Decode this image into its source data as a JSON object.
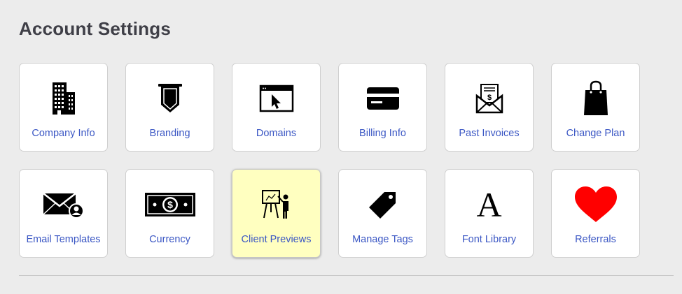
{
  "page": {
    "title": "Account Settings"
  },
  "tiles": [
    {
      "label": "Company Info",
      "icon": "building-icon"
    },
    {
      "label": "Branding",
      "icon": "banner-shield-icon"
    },
    {
      "label": "Domains",
      "icon": "browser-cursor-icon"
    },
    {
      "label": "Billing Info",
      "icon": "credit-card-icon"
    },
    {
      "label": "Past Invoices",
      "icon": "invoice-envelope-icon"
    },
    {
      "label": "Change Plan",
      "icon": "shopping-bag-icon"
    },
    {
      "label": "Email Templates",
      "icon": "envelope-user-icon"
    },
    {
      "label": "Currency",
      "icon": "dollar-bill-icon"
    },
    {
      "label": "Client Previews",
      "icon": "presentation-board-icon",
      "active": true
    },
    {
      "label": "Manage Tags",
      "icon": "tag-icon"
    },
    {
      "label": "Font Library",
      "icon": "letter-a-icon",
      "glyph": "A"
    },
    {
      "label": "Referrals",
      "icon": "heart-icon"
    }
  ],
  "colors": {
    "background": "#ececec",
    "title": "#3f3f47",
    "link": "#3b57c4",
    "active_tile": "#ffffc0",
    "heart": "#ff0000"
  }
}
